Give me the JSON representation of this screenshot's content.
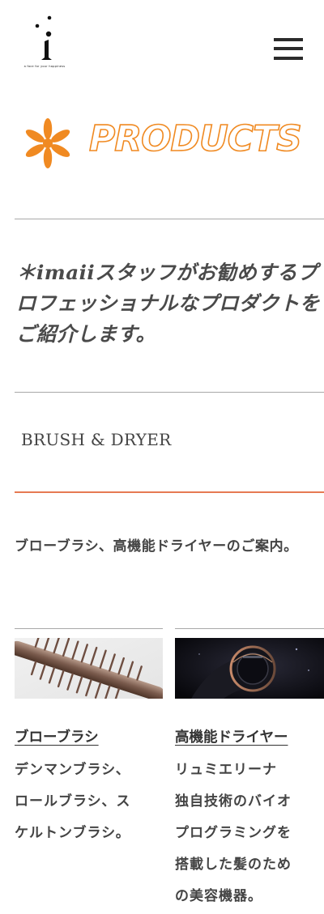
{
  "header": {
    "logo_tagline": "a face for your happiness",
    "menu_label": "menu"
  },
  "hero": {
    "title": "PRODUCTS"
  },
  "intro": {
    "text": "＊imaiiスタッフがお勧めするプロフェッショナルなプロダクトをご紹介します。"
  },
  "section": {
    "title": "BRUSH & DRYER",
    "description": "ブローブラシ、高機能ドライヤーのご案内。"
  },
  "products": [
    {
      "title": "ブローブラシ",
      "lines": [
        "デンマンブラシ、",
        "ロールブラシ、ス",
        "ケルトンブラシ。"
      ]
    },
    {
      "title": "高機能ドライヤー",
      "lines": [
        "リュミエリーナ",
        "独自技術のバイオ",
        "プログラミングを",
        "搭載した髪のため",
        "の美容機器。"
      ]
    }
  ],
  "colors": {
    "accent_orange": "#f08a22",
    "accent_rule": "#e67a52",
    "text": "#444444"
  },
  "icons": {
    "logo": "dotted-i-logo",
    "menu": "hamburger-icon",
    "hero": "asterisk-icon"
  }
}
